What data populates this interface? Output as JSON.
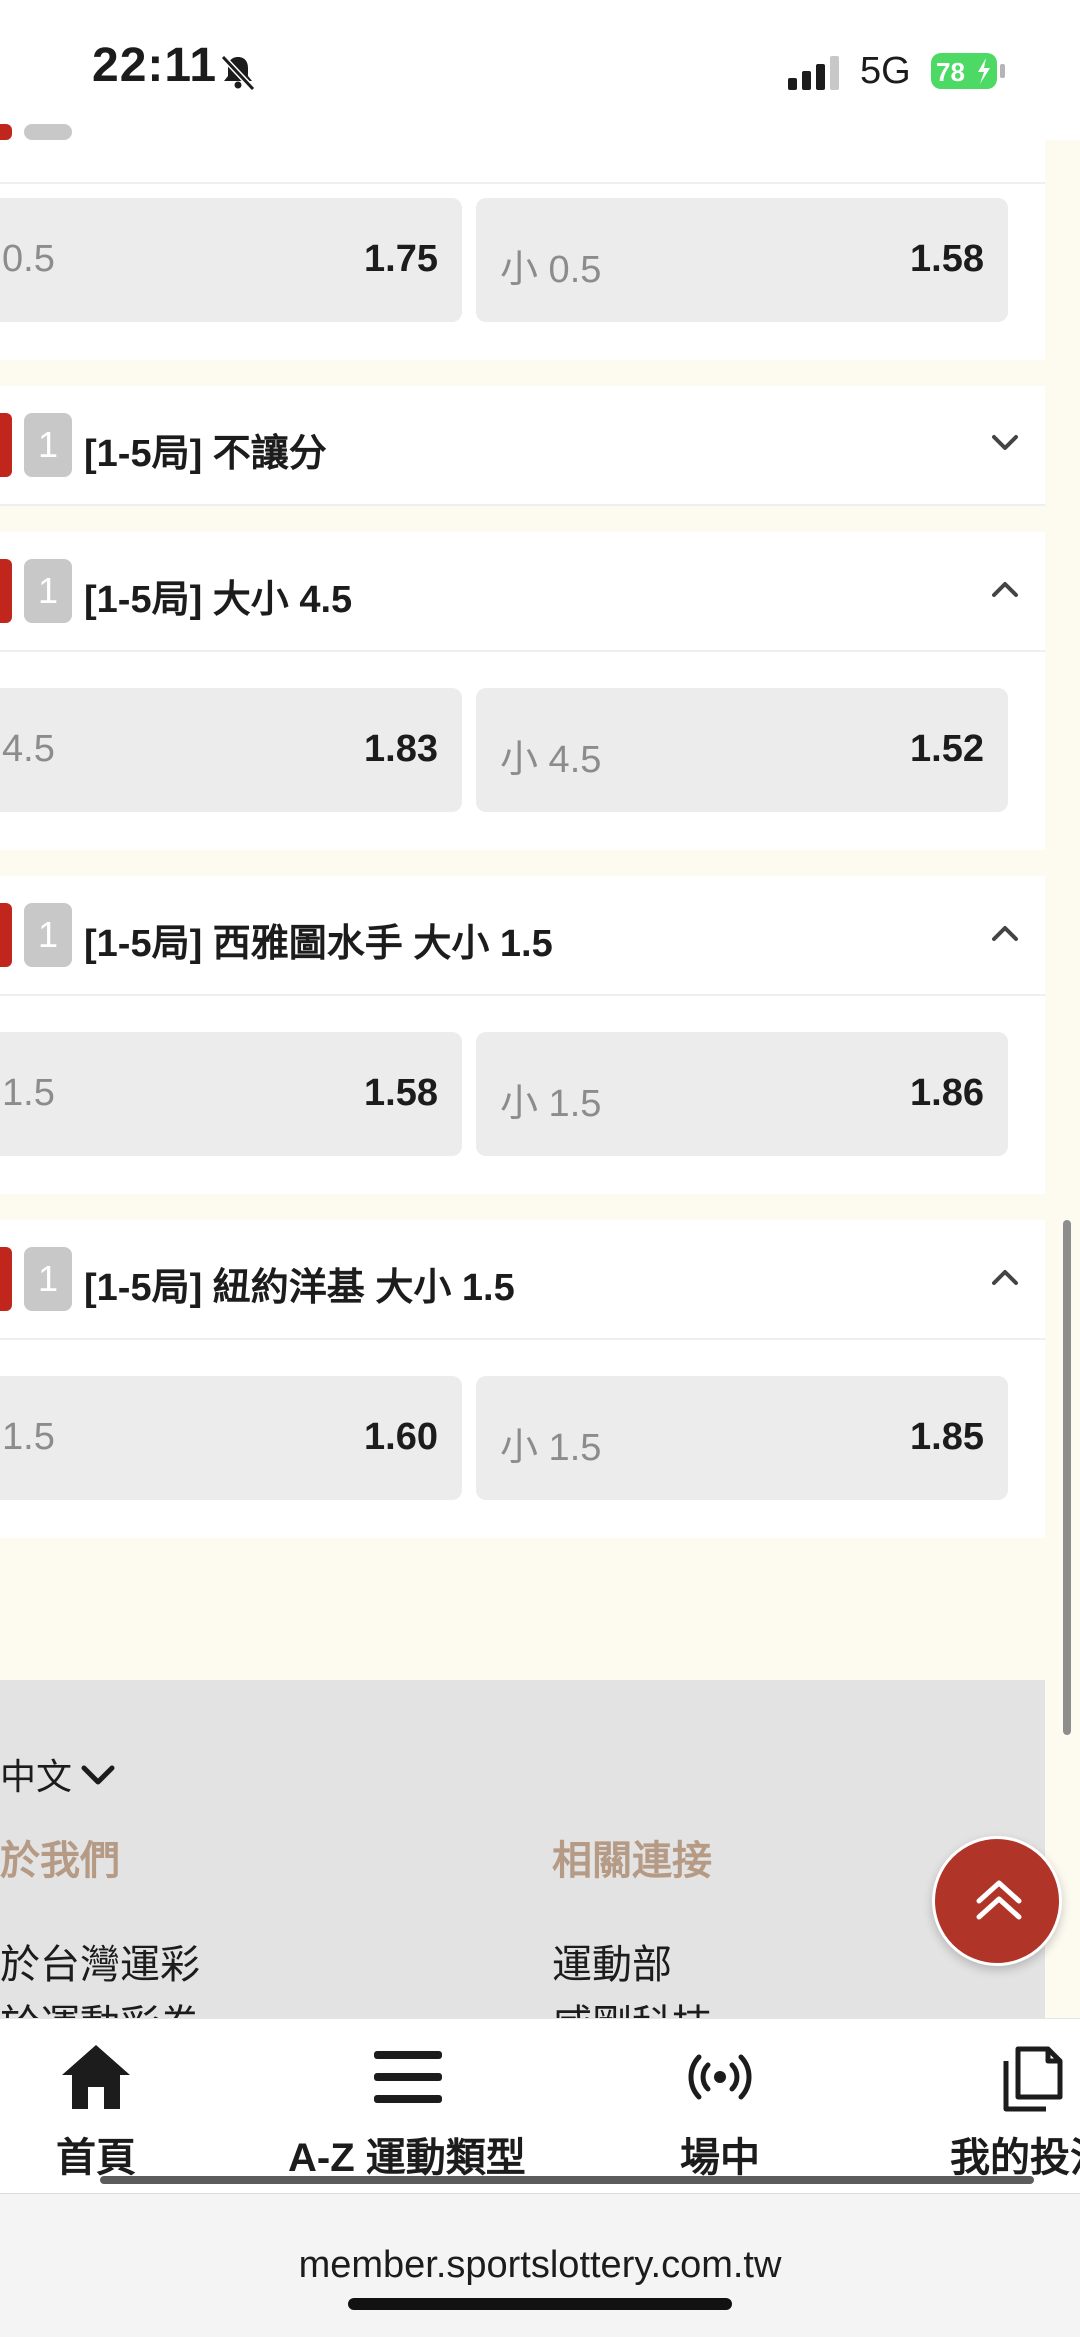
{
  "status_bar": {
    "time": "22:11",
    "network": "5G",
    "battery": "78"
  },
  "markets": [
    {
      "id": "m0",
      "badge": "",
      "title": "",
      "expanded": true,
      "odds": [
        {
          "label": "0.5",
          "value": "1.75"
        },
        {
          "label": "小 0.5",
          "value": "1.58"
        }
      ]
    },
    {
      "id": "m1",
      "badge": "1",
      "title": "[1-5局] 不讓分",
      "expanded": false,
      "odds": []
    },
    {
      "id": "m2",
      "badge": "1",
      "title": "[1-5局] 大小 4.5",
      "expanded": true,
      "odds": [
        {
          "label": "4.5",
          "value": "1.83"
        },
        {
          "label": "小 4.5",
          "value": "1.52"
        }
      ]
    },
    {
      "id": "m3",
      "badge": "1",
      "title": "[1-5局] 西雅圖水手 大小 1.5",
      "expanded": true,
      "odds": [
        {
          "label": "1.5",
          "value": "1.58"
        },
        {
          "label": "小 1.5",
          "value": "1.86"
        }
      ]
    },
    {
      "id": "m4",
      "badge": "1",
      "title": "[1-5局] 紐約洋基 大小 1.5",
      "expanded": true,
      "odds": [
        {
          "label": "1.5",
          "value": "1.60"
        },
        {
          "label": "小 1.5",
          "value": "1.85"
        }
      ]
    }
  ],
  "footer": {
    "language": "中文",
    "about_heading": "於我們",
    "links_heading": "相關連接",
    "about_links": [
      "於台灣運彩",
      "於運動彩券"
    ],
    "related_links": [
      "運動部",
      "威剛科技"
    ]
  },
  "bottom_nav": [
    {
      "label": "首頁",
      "icon": "home-icon"
    },
    {
      "label": "A-Z 運動類型",
      "icon": "menu-icon"
    },
    {
      "label": "場中",
      "icon": "live-icon"
    },
    {
      "label": "我的投注",
      "icon": "bets-icon"
    }
  ],
  "browser": {
    "url": "member.sportslottery.com.tw"
  },
  "colors": {
    "accent_red": "#c0261c",
    "top_button": "#b03528",
    "footer_heading": "#b59a85",
    "page_background": "#fdfaf0"
  }
}
